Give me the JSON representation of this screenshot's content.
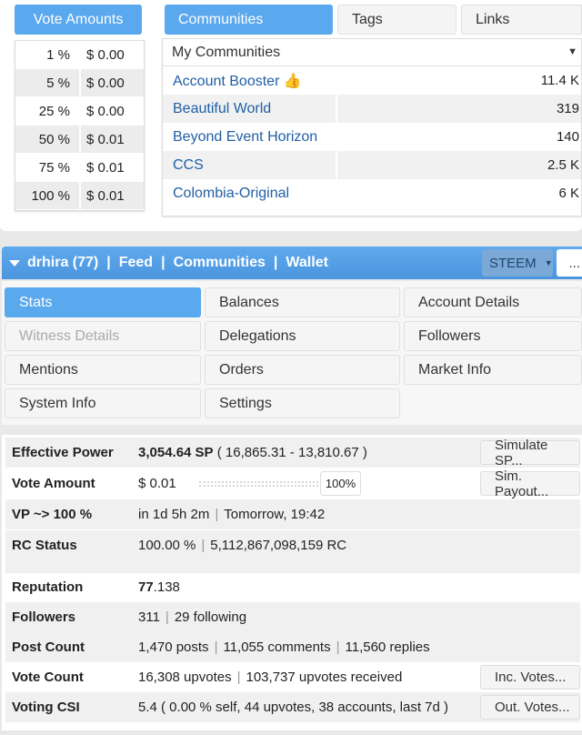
{
  "vote_amounts": {
    "title": "Vote Amounts",
    "rows": [
      {
        "pct": "1 %",
        "amount": "$ 0.00"
      },
      {
        "pct": "5 %",
        "amount": "$ 0.00"
      },
      {
        "pct": "25 %",
        "amount": "$ 0.00"
      },
      {
        "pct": "50 %",
        "amount": "$ 0.01"
      },
      {
        "pct": "75 %",
        "amount": "$ 0.01"
      },
      {
        "pct": "100 %",
        "amount": "$ 0.01"
      }
    ]
  },
  "community_tabs": [
    "Communities",
    "Tags",
    "Links"
  ],
  "communities": {
    "selector": "My Communities",
    "rows": [
      {
        "name": "Account Booster 👍",
        "count": "11.4 K"
      },
      {
        "name": "Beautiful World",
        "count": "319"
      },
      {
        "name": "Beyond Event Horizon",
        "count": "140"
      },
      {
        "name": "CCS",
        "count": "2.5 K"
      },
      {
        "name": "Colombia-Original",
        "count": "6 K"
      }
    ]
  },
  "account_bar": {
    "account": "drhira (77)",
    "links": [
      "Feed",
      "Communities",
      "Wallet"
    ],
    "separator": "|",
    "currency": "STEEM",
    "more": "..."
  },
  "nav": {
    "stats": "Stats",
    "balances": "Balances",
    "account_details": "Account Details",
    "witness_details": "Witness Details",
    "delegations": "Delegations",
    "followers": "Followers",
    "mentions": "Mentions",
    "orders": "Orders",
    "market_info": "Market Info",
    "system_info": "System Info",
    "settings": "Settings"
  },
  "stats": {
    "effective_power": {
      "label": "Effective Power",
      "value": "3,054.64 SP",
      "detail": "( 16,865.31 - 13,810.67 )",
      "button": "Simulate SP..."
    },
    "vote_amount": {
      "label": "Vote Amount",
      "value": "$ 0.01",
      "slider_pct": "100%",
      "slider_level": 1.0,
      "button": "Sim. Payout..."
    },
    "vp": {
      "label": "VP ~> 100 %",
      "value": "in 1d 5h 2m",
      "detail": "Tomorrow, 19:42"
    },
    "rc": {
      "label": "RC Status",
      "value": "100.00 %",
      "detail": "5,112,867,098,159 RC"
    },
    "reputation": {
      "label": "Reputation",
      "value_bold": "77",
      "value_rest": ".138"
    },
    "followers": {
      "label": "Followers",
      "value": "311",
      "detail": "29 following"
    },
    "post_count": {
      "label": "Post Count",
      "value": "1,470 posts",
      "detail": "11,055 comments",
      "detail2": "11,560 replies"
    },
    "vote_count": {
      "label": "Vote Count",
      "value": "16,308 upvotes",
      "detail": "103,737 upvotes received",
      "button": "Inc. Votes..."
    },
    "voting_csi": {
      "label": "Voting CSI",
      "value": "5.4 ( 0.00 % self, 44 upvotes, 38 accounts, last 7d )",
      "button": "Out. Votes..."
    }
  }
}
